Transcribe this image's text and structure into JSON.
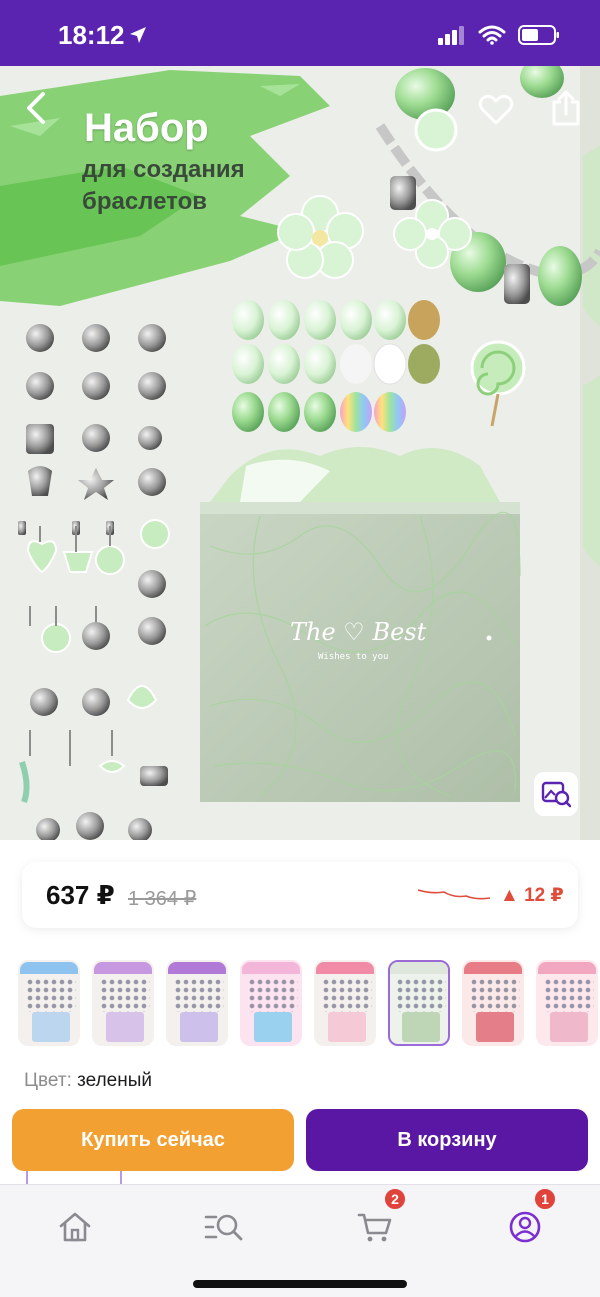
{
  "status_bar": {
    "time": "18:12",
    "icons": [
      "location-arrow-icon",
      "signal-icon",
      "wifi-icon",
      "battery-icon"
    ],
    "background": "#5a23b0"
  },
  "hero": {
    "title": "Набор",
    "subtitle_line1": "для создания",
    "subtitle_line2": "браслетов",
    "box_brand": "The ♡ Best",
    "box_tagline": "Wishes to you",
    "accent_color": "#7fcf6a"
  },
  "price": {
    "current": "637 ₽",
    "old": "1 364 ₽",
    "change": "▲ 12 ₽",
    "change_color": "#e04b3a"
  },
  "thumbnails": [
    {
      "variant": "blue",
      "selected": false
    },
    {
      "variant": "lilac",
      "selected": false
    },
    {
      "variant": "purple",
      "selected": false
    },
    {
      "variant": "unicorn-pink",
      "selected": false
    },
    {
      "variant": "pink",
      "selected": false
    },
    {
      "variant": "green",
      "selected": true
    },
    {
      "variant": "red",
      "selected": false
    },
    {
      "variant": "rose",
      "selected": false
    }
  ],
  "color": {
    "label": "Цвет:",
    "value": "зеленый"
  },
  "actions": {
    "buy_now": "Купить сейчас",
    "add_to_cart": "В корзину",
    "buy_color": "#f3a032",
    "cart_color": "#5a17a3"
  },
  "tabbar": {
    "items": [
      {
        "name": "home",
        "icon": "home-icon"
      },
      {
        "name": "catalog",
        "icon": "catalog-search-icon"
      },
      {
        "name": "cart",
        "icon": "cart-icon",
        "badge": "2"
      },
      {
        "name": "profile",
        "icon": "profile-icon",
        "badge": "1"
      }
    ]
  }
}
